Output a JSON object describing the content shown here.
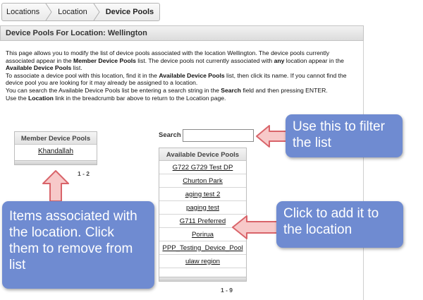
{
  "breadcrumb": {
    "items": [
      "Locations",
      "Location",
      "Device Pools"
    ]
  },
  "panel": {
    "title": "Device Pools For Location: Wellington"
  },
  "description": {
    "p1_part1": "This page allows you to modify the list of device pools associated with the location Wellington. The device pools currently associated appear in the ",
    "p1_bold1": "Member Device Pools",
    "p1_part2": " list. The device pools not currently associated with ",
    "p1_bold2": "any",
    "p1_part3": " location appear in the ",
    "p1_bold3": "Available Device Pools",
    "p1_part4": " list.",
    "p2_part1": "To associate a device pool with this location, find it in the ",
    "p2_bold1": "Available Device Pools",
    "p2_part2": " list, then click its name. If you cannot find the device pool you are looking for it may already be assigned to a location.",
    "p3_part1": "You can search the Available Device Pools list be entering a search string in the ",
    "p3_bold1": "Search",
    "p3_part2": " field and then pressing ENTER.",
    "p4_part1": "Use the ",
    "p4_bold1": "Location",
    "p4_part2": " link in the breadcrumb bar above to return to the Location page."
  },
  "member_pools": {
    "title": "Member Device Pools",
    "items": [
      "Khandallah"
    ],
    "pager": "1 - 2"
  },
  "search": {
    "label": "Search",
    "value": "",
    "placeholder": ""
  },
  "available_pools": {
    "title": "Available Device Pools",
    "items": [
      "G722 G729 Test DP",
      "Churton Park",
      "aging test 2",
      "paging test",
      "G711 Preferred",
      "Porirua",
      "PPP_Testing_Device_Pool",
      "ulaw region"
    ],
    "pager": "1 - 9"
  },
  "callouts": {
    "filter": "Use this to filter the list",
    "add": "Click to add it to the location",
    "remove": "Items associated with the location. Click them to remove from list"
  },
  "colors": {
    "callout_fill": "#6f8bd1",
    "arrow_fill": "#f7c9c9",
    "arrow_stroke": "#d9646a"
  }
}
